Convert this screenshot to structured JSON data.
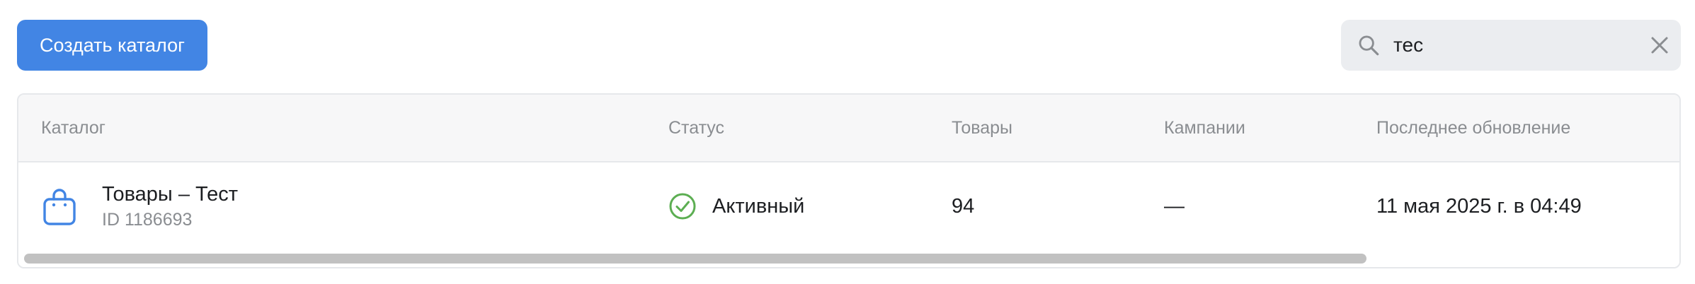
{
  "toolbar": {
    "create_label": "Создать каталог"
  },
  "search": {
    "value": "тес",
    "icon": "search-icon",
    "clear_icon": "close-icon"
  },
  "table": {
    "columns": [
      "Каталог",
      "Статус",
      "Товары",
      "Кампании",
      "Последнее обновление"
    ],
    "rows": [
      {
        "icon": "shopping-bag-icon",
        "name": "Товары – Тест",
        "id": "ID 1186693",
        "status_icon": "check-circle-icon",
        "status": "Активный",
        "products": "94",
        "campaigns": "—",
        "updated": "11 мая 2025 г. в 04:49"
      }
    ]
  },
  "colors": {
    "accent": "#4285e4",
    "status_active": "#5cae52",
    "catalog_icon": "#4285e4"
  }
}
